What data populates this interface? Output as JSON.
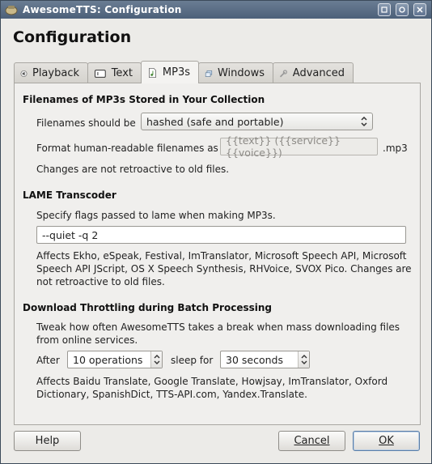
{
  "window": {
    "title": "AwesomeTTS: Configuration"
  },
  "heading": "Configuration",
  "tabs": [
    {
      "label": "Playback",
      "icon": "speaker-icon"
    },
    {
      "label": "Text",
      "icon": "text-box-icon"
    },
    {
      "label": "MP3s",
      "icon": "music-file-icon",
      "active": true
    },
    {
      "label": "Windows",
      "icon": "windows-icon"
    },
    {
      "label": "Advanced",
      "icon": "wrench-icon"
    }
  ],
  "filenames": {
    "heading": "Filenames of MP3s Stored in Your Collection",
    "should_be_label": "Filenames should be",
    "should_be_value": "hashed (safe and portable)",
    "format_label": "Format human-readable filenames as",
    "format_value": "{{text}} ({{service}} {{voice}})",
    "format_suffix": ".mp3",
    "note": "Changes are not retroactive to old files."
  },
  "lame": {
    "heading": "LAME Transcoder",
    "desc": "Specify flags passed to lame when making MP3s.",
    "flags_value": "--quiet -q 2",
    "affects_line1": "Affects Ekho, eSpeak, Festival, ImTranslator, Microsoft Speech API, Microsoft",
    "affects_line2": "Speech API JScript, OS X Speech Synthesis, RHVoice, SVOX Pico. Changes are",
    "affects_line3": "not retroactive to old files."
  },
  "throttle": {
    "heading": "Download Throttling during Batch Processing",
    "desc_line1": "Tweak how often AwesomeTTS takes a break when mass downloading files",
    "desc_line2": "from online services.",
    "after_label": "After",
    "after_value": "10 operations",
    "sleep_label": "sleep for",
    "sleep_value": "30 seconds",
    "affects_line1": "Affects Baidu Translate, Google Translate, Howjsay, ImTranslator, Oxford",
    "affects_line2": "Dictionary, SpanishDict, TTS-API.com, Yandex.Translate."
  },
  "buttons": {
    "help": "Help",
    "cancel": "Cancel",
    "ok": "OK"
  }
}
